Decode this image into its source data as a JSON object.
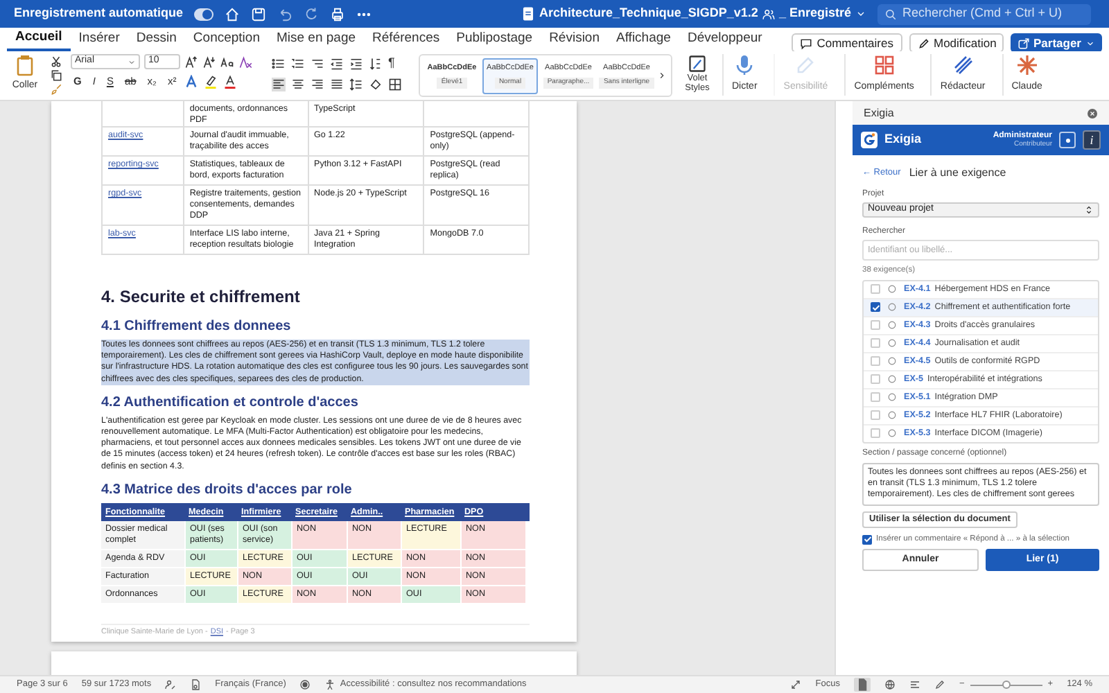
{
  "title_bar": {
    "autosave_label": "Enregistrement automatique",
    "autosave_on": true,
    "document_title": "Architecture_Technique_SIGDP_v1.2",
    "save_status": "_ Enregistré",
    "search_placeholder": "Rechercher (Cmd + Ctrl + U)"
  },
  "ribbon_tabs": [
    {
      "label": "Accueil",
      "selected": true
    },
    {
      "label": "Insérer",
      "selected": false
    },
    {
      "label": "Dessin",
      "selected": false
    },
    {
      "label": "Conception",
      "selected": false
    },
    {
      "label": "Mise en page",
      "selected": false
    },
    {
      "label": "Références",
      "selected": false
    },
    {
      "label": "Publipostage",
      "selected": false
    },
    {
      "label": "Révision",
      "selected": false
    },
    {
      "label": "Affichage",
      "selected": false
    },
    {
      "label": "Développeur",
      "selected": false
    }
  ],
  "ribbon_actions": {
    "comments": "Commentaires",
    "mode": "Modification",
    "share": "Partager"
  },
  "ribbon": {
    "paste": "Coller",
    "font": "Arial",
    "font_size": "10",
    "format_buttons": [
      "G",
      "I",
      "S",
      "ab",
      "x₂",
      "x²"
    ],
    "pilcrow": "¶",
    "styles": [
      {
        "preview": "AaBbCcDdEe",
        "label": "Élevé1",
        "selected": false
      },
      {
        "preview": "AaBbCcDdEe",
        "label": "Normal",
        "selected": true
      },
      {
        "preview": "AaBbCcDdEe",
        "label": "Paragraphe...",
        "selected": false
      },
      {
        "preview": "AaBbCcDdEe",
        "label": "Sans interligne",
        "selected": false
      }
    ],
    "styles_pane": "Volet Styles",
    "tools": [
      {
        "kind": "mic",
        "label": "Dicter",
        "disabled": false
      },
      {
        "kind": "sensitivity",
        "label": "Sensibilité",
        "disabled": true
      },
      {
        "kind": "addins",
        "label": "Compléments",
        "disabled": false
      },
      {
        "kind": "editor",
        "label": "Rédacteur",
        "disabled": false
      },
      {
        "kind": "claude",
        "label": "Claude",
        "disabled": false
      }
    ]
  },
  "document": {
    "services_table": {
      "rows": [
        {
          "cells": [
            null,
            "documents, ordonnances PDF",
            "TypeScript",
            null
          ]
        },
        {
          "cells": [
            "audit-svc",
            "Journal d'audit immuable, traçabilite des acces",
            "Go 1.22",
            "PostgreSQL (append-only)"
          ]
        },
        {
          "cells": [
            "reporting-svc",
            "Statistiques, tableaux de bord, exports facturation",
            "Python 3.12 + FastAPI",
            "PostgreSQL (read replica)"
          ]
        },
        {
          "cells": [
            "rgpd-svc",
            "Registre traitements, gestion consentements, demandes DDP",
            "Node.js 20 + TypeScript",
            "PostgreSQL 16"
          ]
        },
        {
          "cells": [
            "lab-svc",
            "Interface LIS labo interne, reception resultats biologie",
            "Java 21 + Spring Integration",
            "MongoDB 7.0"
          ]
        }
      ]
    },
    "blocks": [
      {
        "kind": "h1",
        "text": "4. Securite et chiffrement"
      },
      {
        "kind": "h2",
        "text": "4.1 Chiffrement des donnees"
      },
      {
        "kind": "p",
        "selected": true,
        "text": "Toutes les donnees sont chiffrees au repos (AES-256) et en transit (TLS 1.3 minimum, TLS 1.2 tolere temporairement). Les cles de chiffrement sont gerees via HashiCorp Vault, deploye en mode haute disponibilite sur l'infrastructure HDS. La rotation automatique des cles est configuree tous les 90 jours. Les sauvegardes sont chiffrees avec des cles specifiques, separees des cles de production."
      },
      {
        "kind": "h2",
        "text": "4.2 Authentification et controle d'acces"
      },
      {
        "kind": "p",
        "selected": false,
        "text": "L'authentification est geree par Keycloak en mode cluster. Les sessions ont une duree de vie de 8 heures avec renouvellement automatique. Le MFA (Multi-Factor Authentication) est obligatoire pour les medecins, pharmaciens, et tout personnel acces aux donnees medicales sensibles. Les tokens JWT ont une duree de vie de 15 minutes (access token) et 24 heures (refresh token). Le contrôle d'acces est base sur les roles (RBAC) definis en section 4.3."
      },
      {
        "kind": "h2",
        "text": "4.3 Matrice des droits d'acces par role"
      }
    ],
    "access_matrix": {
      "columns": [
        "Fonctionnalite",
        "Medecin",
        "Infirmiere",
        "Secretaire",
        "Admin..",
        "Pharmacien",
        "DPO"
      ],
      "rows": [
        {
          "cells": [
            {
              "text": "Dossier medical complet"
            },
            {
              "text": "OUI (ses patients)",
              "color": "#d6f1e0"
            },
            {
              "text": "OUI (son service)",
              "color": "#d6f1e0"
            },
            {
              "text": "NON",
              "color": "#fadcdc"
            },
            {
              "text": "NON",
              "color": "#fadcdc"
            },
            {
              "text": "LECTURE",
              "color": "#fdf7dc"
            },
            {
              "text": "NON",
              "color": "#fadcdc"
            }
          ]
        },
        {
          "cells": [
            {
              "text": "Agenda & RDV"
            },
            {
              "text": "OUI",
              "color": "#d6f1e0"
            },
            {
              "text": "LECTURE",
              "color": "#fdf7dc"
            },
            {
              "text": "OUI",
              "color": "#d6f1e0"
            },
            {
              "text": "LECTURE",
              "color": "#fdf7dc"
            },
            {
              "text": "NON",
              "color": "#fadcdc"
            },
            {
              "text": "NON",
              "color": "#fadcdc"
            }
          ]
        },
        {
          "cells": [
            {
              "text": "Facturation"
            },
            {
              "text": "LECTURE",
              "color": "#fdf7dc"
            },
            {
              "text": "NON",
              "color": "#fadcdc"
            },
            {
              "text": "OUI",
              "color": "#d6f1e0"
            },
            {
              "text": "OUI",
              "color": "#d6f1e0"
            },
            {
              "text": "NON",
              "color": "#fadcdc"
            },
            {
              "text": "NON",
              "color": "#fadcdc"
            }
          ]
        },
        {
          "cells": [
            {
              "text": "Ordonnances"
            },
            {
              "text": "OUI",
              "color": "#d6f1e0"
            },
            {
              "text": "LECTURE",
              "color": "#fdf7dc"
            },
            {
              "text": "NON",
              "color": "#fadcdc"
            },
            {
              "text": "NON",
              "color": "#fadcdc"
            },
            {
              "text": "OUI",
              "color": "#d6f1e0"
            },
            {
              "text": "NON",
              "color": "#fadcdc"
            }
          ]
        }
      ]
    },
    "footer": {
      "text": "Clinique Sainte-Marie de Lyon -",
      "link": "DSI",
      "page": "- Page 3"
    }
  },
  "side_panel": {
    "title": "Exigia",
    "brand": "Exigia",
    "role": "Administrateur",
    "subrole": "Contributeur",
    "info_button": "i",
    "back": "← Retour",
    "heading": "Lier à une exigence",
    "project_label": "Projet",
    "project": "Nouveau projet",
    "search_label": "Rechercher",
    "search_placeholder": "Identifiant ou libellé...",
    "count": "38 exigence(s)",
    "requirements": [
      {
        "id": "EX-4.1",
        "label": "Hébergement HDS en France",
        "checked": false
      },
      {
        "id": "EX-4.2",
        "label": "Chiffrement et authentification forte",
        "checked": true
      },
      {
        "id": "EX-4.3",
        "label": "Droits d'accès granulaires",
        "checked": false
      },
      {
        "id": "EX-4.4",
        "label": "Journalisation et audit",
        "checked": false
      },
      {
        "id": "EX-4.5",
        "label": "Outils de conformité RGPD",
        "checked": false
      },
      {
        "id": "EX-5",
        "label": "Interopérabilité et intégrations",
        "checked": false
      },
      {
        "id": "EX-5.1",
        "label": "Intégration DMP",
        "checked": false
      },
      {
        "id": "EX-5.2",
        "label": "Interface HL7 FHIR (Laboratoire)",
        "checked": false
      },
      {
        "id": "EX-5.3",
        "label": "Interface DICOM (Imagerie)",
        "checked": false
      }
    ],
    "section_label": "Section / passage concerné (optionnel)",
    "section_text": "Toutes les donnees sont chiffrees au repos (AES-256) et en transit (TLS 1.3 minimum, TLS 1.2 tolere temporairement). Les cles de chiffrement sont gerees",
    "use_selection": "Utiliser la sélection du document",
    "insert_comment": {
      "label": "Insérer un commentaire « Répond à ... » à la sélection",
      "checked": true
    },
    "cancel": "Annuler",
    "confirm": "Lier (1)"
  },
  "status_bar": {
    "page": "Page 3 sur 6",
    "words": "59 sur 1723 mots",
    "language": "Français (France)",
    "accessibility": "Accessibilité : consultez nos recommandations",
    "focus": "Focus",
    "zoom_minus": "−",
    "zoom_plus": "+",
    "zoom_slider": {
      "level": 0.5
    },
    "zoom": "124 %"
  }
}
